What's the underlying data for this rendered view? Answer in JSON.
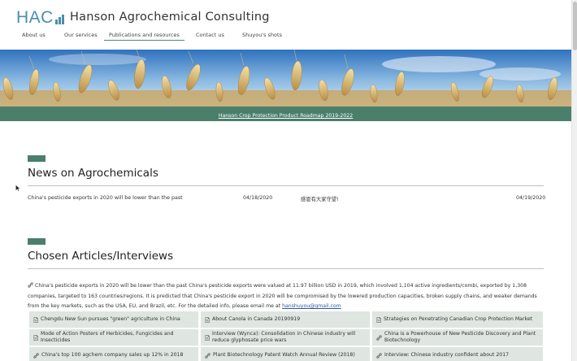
{
  "header": {
    "logo_text": "HAC",
    "brand_color": "#4a8fb0",
    "site_title": "Hanson Agrochemical Consulting"
  },
  "nav": {
    "items": [
      {
        "label": "About us",
        "active": false
      },
      {
        "label": "Our services",
        "active": false
      },
      {
        "label": "Publications and resources",
        "active": true
      },
      {
        "label": "Contact us",
        "active": false
      },
      {
        "label": "Shuyou's shots",
        "active": false
      }
    ]
  },
  "banner": {
    "link_text": "Hanson Crop Protection Product Roadmap 2019-2022",
    "color": "#4a7f6c"
  },
  "news": {
    "title": "News on Agrochemicals",
    "items": [
      {
        "text": "China's pesticide exports in 2020 will be lower than the past",
        "date": "04/18/2020"
      },
      {
        "text": "感恩有大家守望!",
        "date": "04/19/2020"
      }
    ]
  },
  "articles": {
    "title": "Chosen Articles/Interviews",
    "intro_text": "China's pesticide exports in 2020 will be lower than the past China's pesticide exports were valued at 11.97 billion USD in 2019, which involved 1,104 active ingredients/combi, exported by 1,308 companies, targeted to 163 countries/regions. It is predicted that China's pesticide export in 2020 will be compromised by the lowered production capacities, broken supply chains, and weaker demands from the key markets, such as the USA, EU, and Brazil, etc. For the detailed info, please email me at",
    "email": "hanshuyou@gmail.com",
    "items": [
      {
        "label": "Chengdu New Sun pursues \"green\" agriculture in China",
        "icon": "document-icon"
      },
      {
        "label": "About Canola in Canada 20190919",
        "icon": "document-icon"
      },
      {
        "label": "Strategies on Penetrating Canadian Crop Protection Market",
        "icon": "document-icon"
      },
      {
        "label": "Mode of Action Posters of Herbicides, Fungicides and Insecticides",
        "icon": "document-icon"
      },
      {
        "label": "Interview (Wynca): Consolidation in Chinese industry will reduce glyphosate price wars",
        "icon": "document-icon"
      },
      {
        "label": "China is a Powerhouse of New Pesticide Discovery and Plant Biotechnology",
        "icon": "link-icon"
      },
      {
        "label": "China's top 100 agchem company sales up 12% in 2018",
        "icon": "link-icon"
      },
      {
        "label": "Plant Biotechnology Patent Watch Annual Review (2018)",
        "icon": "link-icon"
      },
      {
        "label": "Interview: Chinese industry confident about 2017",
        "icon": "link-icon"
      }
    ]
  }
}
